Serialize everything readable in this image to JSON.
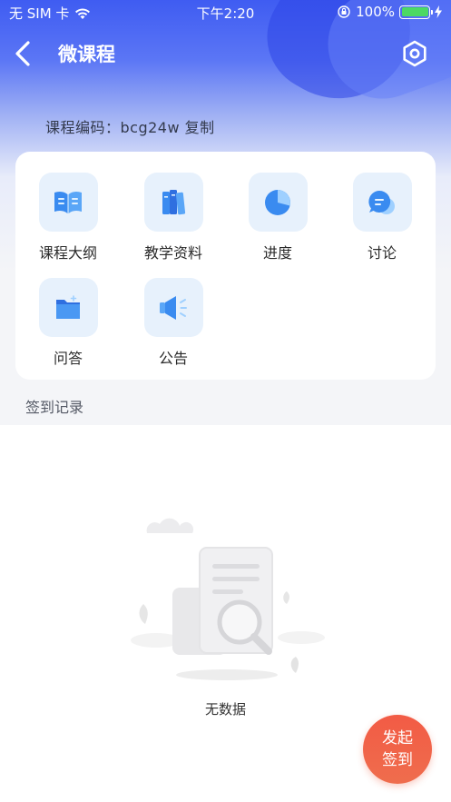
{
  "status_bar": {
    "carrier": "无 SIM 卡",
    "time": "下午2:20",
    "battery": "100%"
  },
  "nav": {
    "title": "微课程",
    "back_icon": "chevron-left-icon",
    "settings_icon": "hexagon-settings-icon"
  },
  "course_code": "课程编码：bcg24w 复制",
  "menu": [
    {
      "label": "课程大纲",
      "icon": "book-icon"
    },
    {
      "label": "教学资料",
      "icon": "books-icon"
    },
    {
      "label": "进度",
      "icon": "pie-chart-icon"
    },
    {
      "label": "讨论",
      "icon": "chat-bubble-icon"
    },
    {
      "label": "问答",
      "icon": "folder-icon"
    },
    {
      "label": "公告",
      "icon": "megaphone-icon"
    }
  ],
  "section": {
    "title": "签到记录"
  },
  "empty": {
    "text": "无数据"
  },
  "fab": {
    "line1": "发起",
    "line2": "签到"
  },
  "colors": {
    "primary": "#3f5cf2",
    "icon_tile_bg": "#e7f1fc",
    "icon_blue": "#3a8bf0",
    "fab": "#f0604a"
  }
}
